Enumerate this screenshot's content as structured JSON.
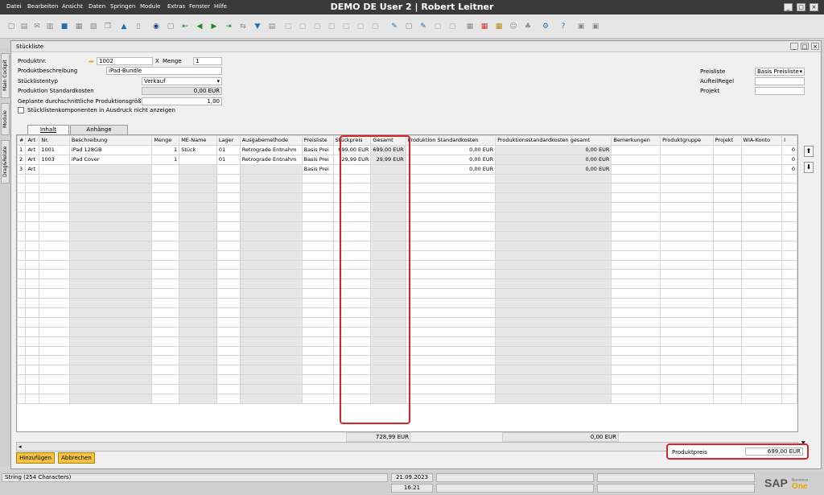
{
  "app": {
    "title": "DEMO DE User 2 | Robert Leitner",
    "menu": [
      "Datei",
      "Bearbeiten",
      "Ansicht",
      "Daten",
      "Springen",
      "Module",
      "Extras",
      "Fenster",
      "Hilfe"
    ]
  },
  "side_tabs": [
    "Main Cockpit",
    "Module",
    "Drag&Relate"
  ],
  "window": {
    "title": "Stückliste"
  },
  "form": {
    "produktnr_label": "Produktnr.",
    "produktnr_value": "1002",
    "x_label": "X",
    "menge_label": "Menge",
    "menge_value": "1",
    "produktbeschreibung_label": "Produktbeschreibung",
    "produktbeschreibung_value": "iPad-Bundle",
    "stuecklistentyp_label": "Stücklistentyp",
    "stuecklistentyp_value": "Verkauf",
    "standardkosten_label": "Produktion Standardkosten",
    "standardkosten_value": "0,00 EUR",
    "geplante_label": "Geplante durchschnittliche Produktionsgröße",
    "geplante_value": "1,00",
    "checkbox_label": "Stücklistenkomponenten in Ausdruck nicht anzeigen",
    "preisliste_label": "Preisliste",
    "preisliste_value": "Basis Preisliste",
    "aufteilregel_label": "AufteilRegel",
    "projekt_label": "Projekt"
  },
  "tabs": [
    "Inhalt",
    "Anhänge"
  ],
  "grid": {
    "headers": [
      "#",
      "Art",
      "Nr.",
      "Beschreibung",
      "Menge",
      "ME-Name",
      "Lager",
      "Ausgabemethode",
      "Preisliste",
      "Stückpreis",
      "Gesamt",
      "Produktion Standardkosten",
      "Produktionsstandardkosten gesamt",
      "Bemerkungen",
      "Produktgruppe",
      "Projekt",
      "WIA-Konto",
      "I"
    ],
    "rows": [
      [
        "1",
        "Art",
        "1001",
        "iPad 128GB",
        "1",
        "Stück",
        "01",
        "Retrograde Entnahm",
        "Basis Prei",
        "699,00 EUR",
        "699,00 EUR",
        "0,00 EUR",
        "0,00 EUR",
        "",
        "",
        "",
        "",
        "0"
      ],
      [
        "2",
        "Art",
        "1003",
        "iPad Cover",
        "1",
        "",
        "01",
        "Retrograde Entnahm",
        "Basis Prei",
        "29,99 EUR",
        "29,99 EUR",
        "0,00 EUR",
        "0,00 EUR",
        "",
        "",
        "",
        "",
        "0"
      ],
      [
        "3",
        "Art",
        "",
        "",
        "",
        "",
        "",
        "",
        "Basis Prei",
        "",
        "",
        "0,00 EUR",
        "0,00 EUR",
        "",
        "",
        "",
        "",
        "0"
      ]
    ],
    "sum_gesamt": "728,99 EUR",
    "sum_prodkosten_gesamt": "0,00 EUR"
  },
  "produktpreis": {
    "label": "Produktpreis",
    "value": "699,00 EUR"
  },
  "buttons": {
    "add": "Hinzufügen",
    "cancel": "Abbrechen"
  },
  "status": {
    "field_info": "String (254 Characters)",
    "date": "21.09.2023",
    "time": "16:21",
    "logo": "SAP Business One"
  },
  "colors": {
    "accent": "#f5c242",
    "highlight": "#d9242a",
    "menubar": "#3a3a3a"
  }
}
